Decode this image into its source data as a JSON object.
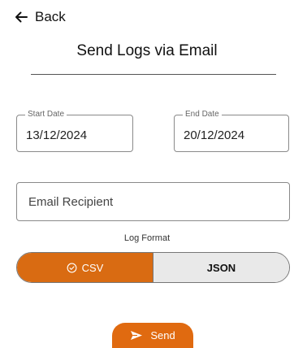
{
  "nav": {
    "back_label": "Back",
    "back_icon": "arrow-left-icon"
  },
  "title": "Send Logs via Email",
  "dates": {
    "start": {
      "label": "Start Date",
      "value": "13/12/2024"
    },
    "end": {
      "label": "End Date",
      "value": "20/12/2024"
    }
  },
  "email": {
    "placeholder": "Email Recipient",
    "value": ""
  },
  "log_format": {
    "label": "Log Format",
    "options": [
      {
        "label": "CSV",
        "selected": true,
        "icon": "check-circle-icon"
      },
      {
        "label": "JSON",
        "selected": false
      }
    ]
  },
  "send_button": {
    "label": "Send",
    "icon": "send-icon"
  },
  "colors": {
    "accent": "#D96B12",
    "unselected": "#E9E9E9"
  }
}
